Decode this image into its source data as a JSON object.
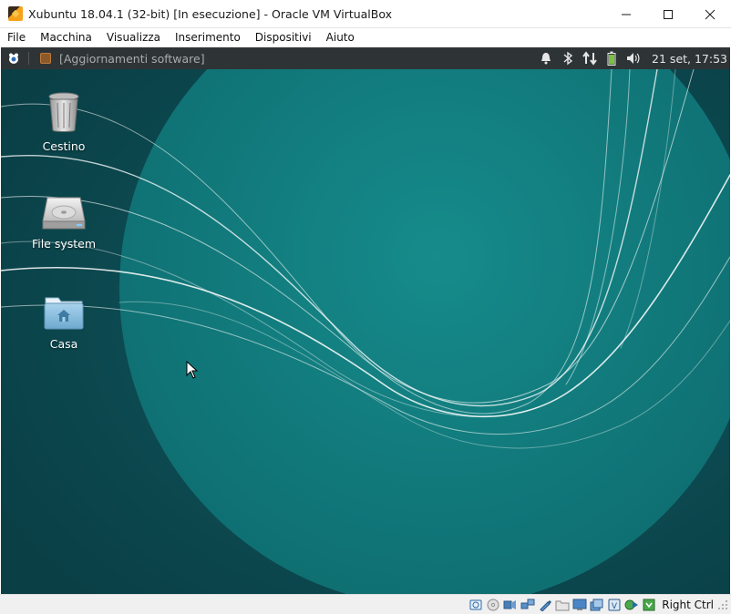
{
  "window": {
    "title": "Xubuntu 18.04.1 (32-bit) [In esecuzione] - Oracle VM VirtualBox",
    "minimize_glyph": "—",
    "maximize_glyph": "☐",
    "close_glyph": "✕"
  },
  "menubar": {
    "items": [
      "File",
      "Macchina",
      "Visualizza",
      "Inserimento",
      "Dispositivi",
      "Aiuto"
    ]
  },
  "panel": {
    "task_label": "[Aggiornamenti software]",
    "clock": "21 set, 17:53",
    "tray_icons": [
      "notification-bell-icon",
      "bluetooth-icon",
      "network-transfer-icon",
      "battery-icon",
      "volume-icon"
    ]
  },
  "desktop": {
    "icons": [
      {
        "label": "Cestino",
        "icon": "trash-icon"
      },
      {
        "label": "File system",
        "icon": "hard-drive-icon"
      },
      {
        "label": "Casa",
        "icon": "home-folder-icon"
      }
    ],
    "background_colors": {
      "base": "#0e4a50",
      "circle": "#138787",
      "lines": "#ffffff"
    }
  },
  "statusbar": {
    "icons": [
      "hard-disk-icon",
      "optical-drive-icon",
      "audio-icon",
      "network-icon",
      "usb-icon",
      "shared-folders-icon",
      "display-icon",
      "video-capture-icon",
      "virtualization-icon",
      "mouse-integration-icon",
      "host-key-icon"
    ],
    "host_key": "Right Ctrl"
  },
  "colors": {
    "panel_bg": "#2e3436",
    "accent": "#138787"
  }
}
